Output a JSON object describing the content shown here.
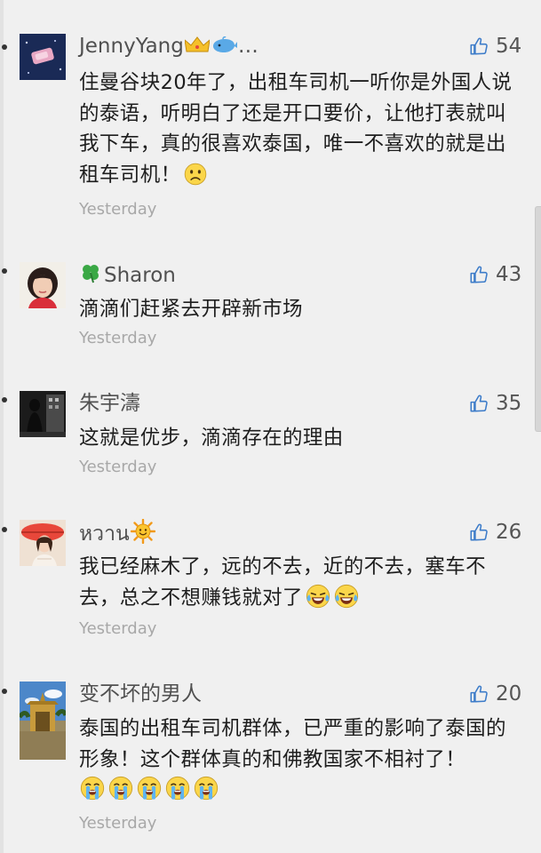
{
  "comments": [
    {
      "name": "JennyYang",
      "name_suffix": "…",
      "name_icons": [
        "crown-icon",
        "whale-icon"
      ],
      "likes": "54",
      "text": "住曼谷块20年了，出租车司机一听你是外国人说的泰语，听明白了还是开口要价，让他打表就叫我下车，真的很喜欢泰国，唯一不喜欢的就是出租车司机！",
      "emoji": [
        "frown-face-icon"
      ],
      "time": "Yesterday"
    },
    {
      "name": "Sharon",
      "name_prefix_icon": "four-leaf-clover-icon",
      "likes": "43",
      "text": "滴滴们赶紧去开辟新市场",
      "time": "Yesterday"
    },
    {
      "name": "朱宇濤",
      "likes": "35",
      "text": "这就是优步，滴滴存在的理由",
      "time": "Yesterday"
    },
    {
      "name": "หวาน",
      "name_icons": [
        "sun-face-icon"
      ],
      "likes": "26",
      "text": "我已经麻木了，远的不去，近的不去，塞车不去，总之不想赚钱就对了",
      "emoji": [
        "laughing-crying-face-icon",
        "laughing-crying-face-icon"
      ],
      "time": "Yesterday"
    },
    {
      "name": "变不坏的男人",
      "likes": "20",
      "text": "泰国的出租车司机群体，已严重的影响了泰国的形象！这个群体真的和佛教国家不相衬了！",
      "emoji": [
        "loudly-crying-face-icon",
        "loudly-crying-face-icon",
        "loudly-crying-face-icon",
        "loudly-crying-face-icon",
        "loudly-crying-face-icon"
      ],
      "time": "Yesterday"
    }
  ],
  "colors": {
    "background": "#f0f0f0",
    "like_icon": "#3d7cc9",
    "timestamp": "#a8a8a8",
    "name": "#505050"
  }
}
